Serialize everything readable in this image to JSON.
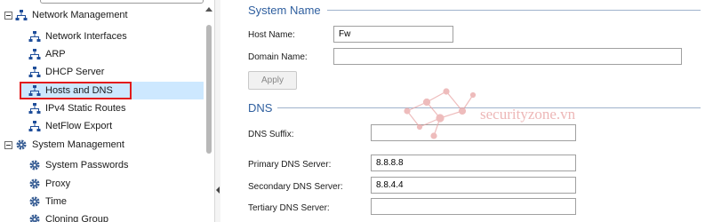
{
  "tree": {
    "items": [
      {
        "label": "Network Management",
        "icon": "network-icon",
        "level": 0,
        "expanded": true
      },
      {
        "label": "Network Interfaces",
        "icon": "network-icon",
        "level": 1
      },
      {
        "label": "ARP",
        "icon": "network-icon",
        "level": 1
      },
      {
        "label": "DHCP Server",
        "icon": "network-icon",
        "level": 1
      },
      {
        "label": "Hosts and DNS",
        "icon": "network-icon",
        "level": 1,
        "selected": true
      },
      {
        "label": "IPv4 Static Routes",
        "icon": "network-icon",
        "level": 1
      },
      {
        "label": "NetFlow Export",
        "icon": "network-icon",
        "level": 1
      },
      {
        "label": "System Management",
        "icon": "gear-icon",
        "level": 0,
        "expanded": true
      },
      {
        "label": "System Passwords",
        "icon": "gear-icon",
        "level": 1
      },
      {
        "label": "Proxy",
        "icon": "gear-icon",
        "level": 1
      },
      {
        "label": "Time",
        "icon": "gear-icon",
        "level": 1
      },
      {
        "label": "Cloning Group",
        "icon": "gear-icon",
        "level": 1
      }
    ]
  },
  "system_name": {
    "title": "System Name",
    "host_name_label": "Host Name:",
    "host_name_value": "Fw",
    "domain_name_label": "Domain Name:",
    "domain_name_value": "",
    "apply_label": "Apply"
  },
  "dns": {
    "title": "DNS",
    "suffix_label": "DNS Suffix:",
    "suffix_value": "",
    "primary_label": "Primary DNS Server:",
    "primary_value": "8.8.8.8",
    "secondary_label": "Secondary DNS Server:",
    "secondary_value": "8.8.4.4",
    "tertiary_label": "Tertiary DNS Server:",
    "tertiary_value": ""
  },
  "watermark": {
    "text": "securityzone.vn"
  },
  "colors": {
    "section_title": "#2f5f9f",
    "selection": "#cde8ff",
    "highlight": "#e21b1b",
    "network_icon": "#1f4e9a",
    "gear_icon": "#3a5f95",
    "watermark": "#e8a0a0"
  }
}
